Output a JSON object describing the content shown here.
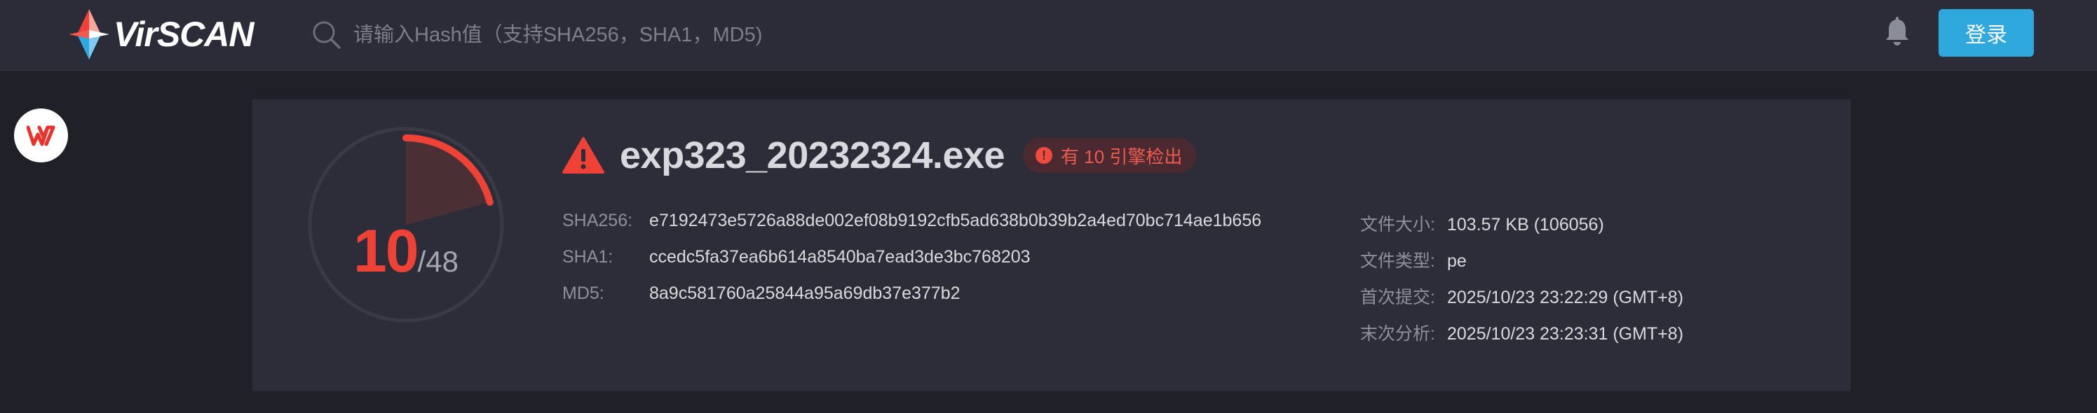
{
  "header": {
    "logo_text": "VirSCAN",
    "search_placeholder": "请输入Hash值（支持SHA256，SHA1，MD5)",
    "login_label": "登录",
    "icons": {
      "search": "search-icon",
      "bell": "bell-icon"
    }
  },
  "side": {
    "icon": "wps-icon"
  },
  "file": {
    "name": "exp323_20232324.exe",
    "detect_badge": "有 10 引擎检出",
    "detected": "10",
    "total": "/48",
    "hashes": [
      {
        "label": "SHA256:",
        "value": "e7192473e5726a88de002ef08b9192cfb5ad638b0b39b2a4ed70bc714ae1b656"
      },
      {
        "label": "SHA1:",
        "value": "ccedc5fa37ea6b614a8540ba7ead3de3bc768203"
      },
      {
        "label": "MD5:",
        "value": "8a9c581760a25844a95a69db37e377b2"
      }
    ],
    "meta": [
      {
        "label": "文件大小:",
        "value": "103.57 KB (106056)"
      },
      {
        "label": "文件类型:",
        "value": "pe"
      },
      {
        "label": "首次提交:",
        "value": "2025/10/23 23:22:29 (GMT+8)"
      },
      {
        "label": "末次分析:",
        "value": "2025/10/23 23:23:31 (GMT+8)"
      }
    ]
  },
  "colors": {
    "accent_red": "#ee4236",
    "button_blue": "#2fa8de",
    "topbar_bg": "#2b2c37",
    "page_bg": "#1f2028",
    "card_bg": "#2c2d38"
  }
}
